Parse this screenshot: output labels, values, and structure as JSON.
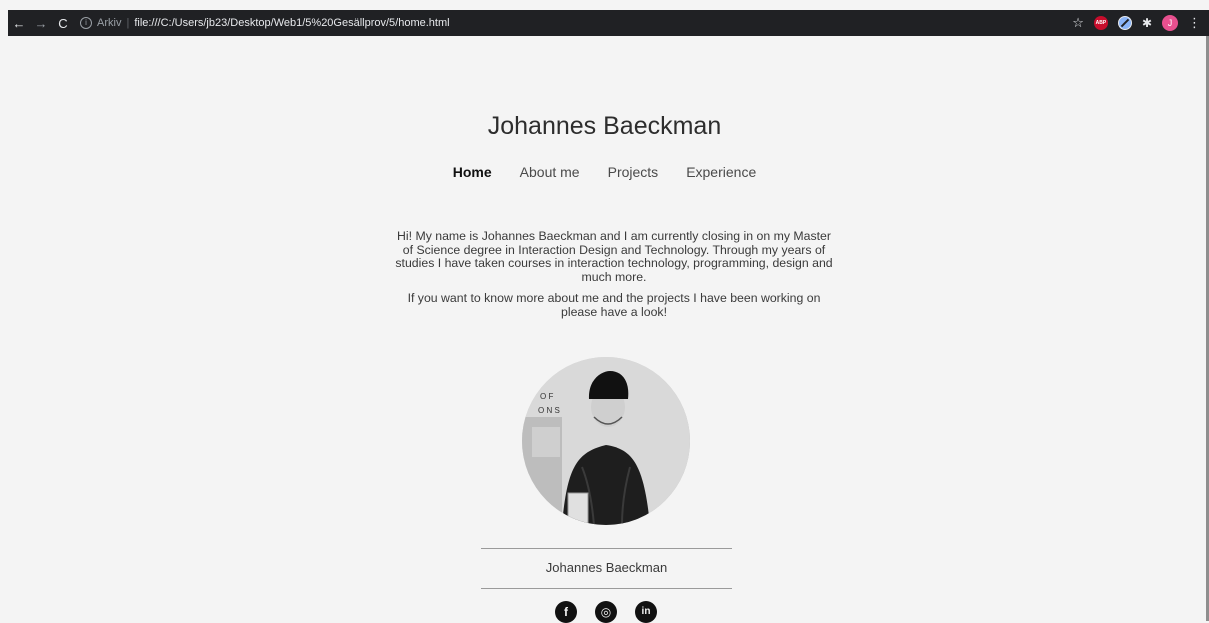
{
  "browser": {
    "back_icon": "←",
    "forward_icon": "→",
    "reload_icon": "C",
    "info_icon": "i",
    "url_prefix": "Arkiv",
    "url_separator": "|",
    "url": "file:///C:/Users/jb23/Desktop/Web1/5%20Gesällprov/5/home.html",
    "star_icon": "☆",
    "ext_abp_label": "ABP",
    "puzzle_icon": "✱",
    "profile_initial": "J",
    "menu_icon": "⋮"
  },
  "site": {
    "title": "Johannes Baeckman",
    "nav": [
      {
        "label": "Home",
        "active": true
      },
      {
        "label": "About me",
        "active": false
      },
      {
        "label": "Projects",
        "active": false
      },
      {
        "label": "Experience",
        "active": false
      }
    ],
    "intro_paragraphs": [
      "Hi! My name is Johannes Baeckman and I am currently closing in on my Master of Science degree in Interaction Design and Technology. Through my years of studies I have taken courses in interaction technology, programming, design and much more.",
      "If you want to know more about me and the projects I have been working on please have a look!"
    ],
    "photo_text": [
      "O F",
      "O N S"
    ],
    "footer_name": "Johannes Baeckman",
    "socials": [
      {
        "name": "facebook",
        "glyph": "f"
      },
      {
        "name": "instagram",
        "glyph": "◎"
      },
      {
        "name": "linkedin",
        "glyph": "in"
      }
    ]
  }
}
